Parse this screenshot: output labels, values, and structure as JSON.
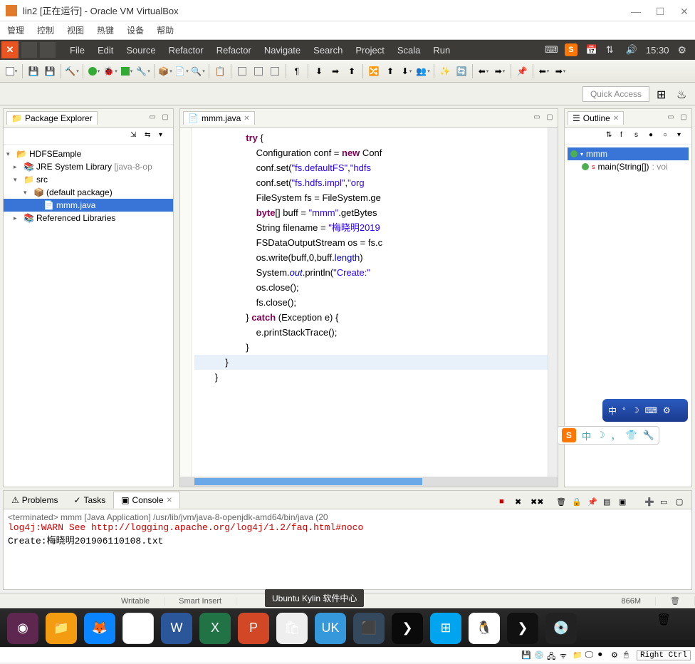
{
  "vb": {
    "title": "lin2 [正在运行] - Oracle VM VirtualBox",
    "menu": [
      "管理",
      "控制",
      "视图",
      "热键",
      "设备",
      "帮助"
    ],
    "status_key": "Right Ctrl"
  },
  "unity": {
    "menu": [
      "File",
      "Edit",
      "Source",
      "Refactor",
      "Refactor",
      "Navigate",
      "Search",
      "Project",
      "Scala",
      "Run"
    ],
    "time": "15:30"
  },
  "eclipse": {
    "quick_access": "Quick Access",
    "package_explorer": {
      "title": "Package Explorer",
      "items": {
        "project": "HDFSEample",
        "jre": "JRE System Library",
        "jre_ver": "[java-8-op",
        "src": "src",
        "pkg": "(default package)",
        "file": "mmm.java",
        "ref": "Referenced Libraries"
      }
    },
    "editor": {
      "tab": "mmm.java",
      "code_lines": [
        "                    try {",
        "                        Configuration conf = new Conf",
        "                        conf.set(\"fs.defaultFS\",\"hdfs",
        "                        conf.set(\"fs.hdfs.impl\",\"org",
        "                        FileSystem fs = FileSystem.ge",
        "                        byte[] buff = \"mmm\".getBytes",
        "                        String filename = \"梅晓明2019",
        "                        FSDataOutputStream os = fs.c",
        "                        os.write(buff,0,buff.length)",
        "                        System.out.println(\"Create:\"",
        "                        os.close();",
        "                        fs.close();",
        "                    } catch (Exception e) {",
        "                        e.printStackTrace();",
        "                    }",
        "            }",
        "        }"
      ]
    },
    "outline": {
      "title": "Outline",
      "class": "mmm",
      "method": "main(String[])",
      "ret": ": voi"
    },
    "console": {
      "tabs": {
        "problems": "Problems",
        "tasks": "Tasks",
        "console": "Console"
      },
      "term": "<terminated> mmm [Java Application] /usr/lib/jvm/java-8-openjdk-amd64/bin/java (20",
      "warn": "log4j:WARN See http://logging.apache.org/log4j/1.2/faq.html#noco",
      "out": "Create:梅晓明201906110108.txt"
    },
    "status": {
      "writable": "Writable",
      "insert": "Smart Insert",
      "mem": "866M"
    },
    "tooltip": "Ubuntu Kylin 软件中心"
  },
  "ime": {
    "lang": "中",
    "moon": "☽",
    "punct": "，"
  },
  "dock": {
    "apps": [
      "dash",
      "files",
      "firefox",
      "chromium",
      "word",
      "excel",
      "powerpoint",
      "bag",
      "ukylin-center",
      "devices",
      "forward",
      "settings",
      "qq",
      "terminal",
      "disc"
    ]
  }
}
